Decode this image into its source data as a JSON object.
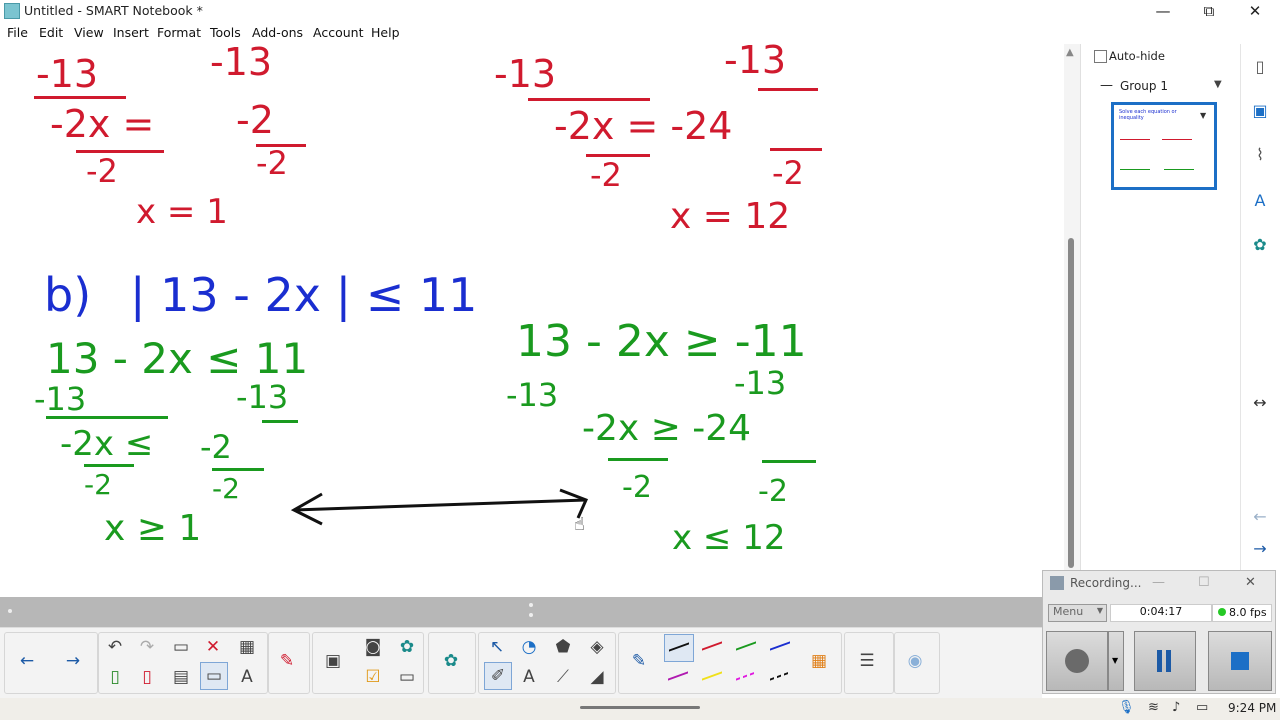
{
  "window": {
    "title": "Untitled - SMART Notebook *",
    "minimize": "—",
    "restore": "⧉",
    "close": "✕"
  },
  "menu": [
    "File",
    "Edit",
    "View",
    "Insert",
    "Format",
    "Tools",
    "Add-ons",
    "Account",
    "Help"
  ],
  "canvas": {
    "top_left": {
      "l1": "-13",
      "l1b": "-13",
      "l2": "-2x =",
      "l2b": "-2",
      "l3": "-2",
      "l3b": "-2",
      "ans": "x = 1"
    },
    "top_right": {
      "l1": "-13",
      "l1b": "-13",
      "l2": "-2x = -24",
      "l3": "-2",
      "l3b": "-2",
      "ans": "x = 12"
    },
    "b_label": "b)",
    "b_expr": "| 13 - 2x | ≤ 11",
    "left": {
      "l1": "13 - 2x ≤ 11",
      "l2a": "-13",
      "l2b": "-13",
      "l3": "-2x ≤",
      "l3b": "-2",
      "l4": "-2",
      "l4b": "-2",
      "ans": "x ≥ 1"
    },
    "right": {
      "l1": "13 - 2x ≥ -11",
      "l2a": "-13",
      "l2b": "-13",
      "l3": "-2x ≥ -24",
      "l4": "-2",
      "l4b": "-2",
      "ans": "x ≤ 12"
    }
  },
  "side": {
    "autohide": "Auto-hide",
    "group": "Group 1",
    "thumb_caption": "Solve each equation or inequality"
  },
  "recorder": {
    "title": "Recording...",
    "menu": "Menu",
    "time": "0:04:17",
    "fps": "8.0 fps"
  },
  "tray": {
    "time": "9:24 PM"
  },
  "colors": {
    "red": "#d01a2e",
    "green": "#1a9a1f",
    "blue": "#1a2ed0",
    "accent": "#1c6fc6"
  }
}
